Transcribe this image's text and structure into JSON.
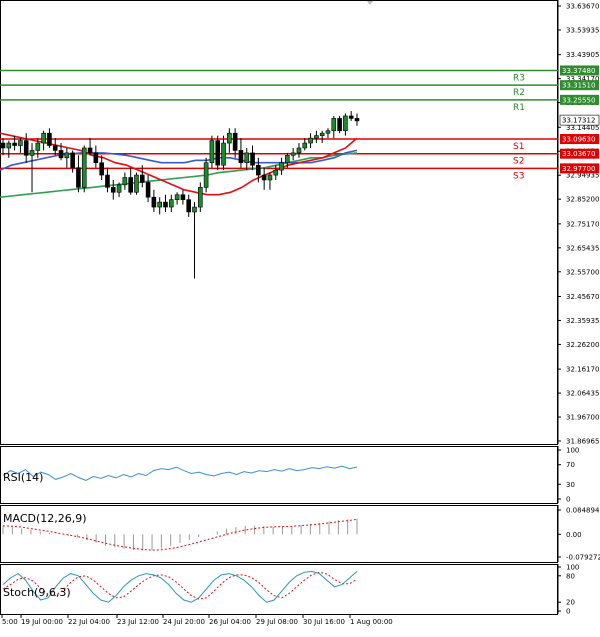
{
  "chart_data": [
    {
      "panel": "price",
      "type": "candlestick",
      "y_ticks": [
        "33.63670",
        "33.53935",
        "33.43905",
        "33.34170",
        "33.24435",
        "33.14405",
        "33.04670",
        "32.94935",
        "32.85200",
        "32.75170",
        "32.65435",
        "32.55700",
        "32.45670",
        "32.35935",
        "32.26200",
        "32.16170",
        "32.06435",
        "31.96700",
        "31.86965"
      ],
      "ylim": [
        31.86965,
        33.6367
      ],
      "current_price": {
        "value": 33.17312,
        "label": "33.17312"
      },
      "levels": [
        {
          "name": "R3",
          "value": 33.3748,
          "label": "33.37480",
          "color": "#2e8b2e"
        },
        {
          "name": "R2",
          "value": 33.3151,
          "label": "33.31510",
          "color": "#2e8b2e"
        },
        {
          "name": "R1",
          "value": 33.2555,
          "label": "33.25550",
          "color": "#2e8b2e"
        },
        {
          "name": "S1",
          "value": 33.0963,
          "label": "33.09630",
          "color": "#e00000"
        },
        {
          "name": "S2",
          "value": 33.0367,
          "label": "33.03670",
          "color": "#e00000"
        },
        {
          "name": "S3",
          "value": 32.977,
          "label": "32.97700",
          "color": "#e00000"
        }
      ],
      "candles": [
        [
          33.08,
          33.1,
          33.03,
          33.06
        ],
        [
          33.06,
          33.09,
          33.02,
          33.08
        ],
        [
          33.08,
          33.11,
          33.05,
          33.07
        ],
        [
          33.07,
          33.1,
          33.04,
          33.09
        ],
        [
          33.09,
          33.12,
          33.0,
          33.03
        ],
        [
          33.03,
          33.08,
          32.88,
          33.05
        ],
        [
          33.05,
          33.1,
          33.02,
          33.08
        ],
        [
          33.08,
          33.13,
          33.05,
          33.12
        ],
        [
          33.12,
          33.14,
          33.06,
          33.07
        ],
        [
          33.07,
          33.1,
          33.03,
          33.05
        ],
        [
          33.05,
          33.08,
          33.01,
          33.02
        ],
        [
          33.02,
          33.06,
          32.98,
          33.04
        ],
        [
          33.04,
          33.05,
          32.96,
          32.98
        ],
        [
          32.98,
          33.03,
          32.88,
          32.9
        ],
        [
          32.9,
          33.07,
          32.88,
          33.06
        ],
        [
          33.06,
          33.1,
          33.03,
          33.04
        ],
        [
          33.04,
          33.07,
          32.98,
          33.0
        ],
        [
          33.0,
          33.03,
          32.93,
          32.95
        ],
        [
          32.95,
          32.98,
          32.88,
          32.9
        ],
        [
          32.9,
          32.93,
          32.85,
          32.88
        ],
        [
          32.88,
          32.92,
          32.86,
          32.91
        ],
        [
          32.91,
          32.96,
          32.89,
          32.94
        ],
        [
          32.94,
          32.98,
          32.87,
          32.88
        ],
        [
          32.88,
          32.96,
          32.87,
          32.95
        ],
        [
          32.95,
          32.99,
          32.9,
          32.92
        ],
        [
          32.92,
          32.95,
          32.84,
          32.86
        ],
        [
          32.86,
          32.89,
          32.8,
          32.82
        ],
        [
          32.82,
          32.86,
          32.79,
          32.84
        ],
        [
          32.84,
          32.87,
          32.8,
          32.82
        ],
        [
          32.82,
          32.87,
          32.8,
          32.85
        ],
        [
          32.85,
          32.88,
          32.83,
          32.87
        ],
        [
          32.87,
          32.89,
          32.83,
          32.85
        ],
        [
          32.85,
          32.87,
          32.78,
          32.8
        ],
        [
          32.8,
          32.84,
          32.53,
          32.82
        ],
        [
          32.82,
          32.92,
          32.8,
          32.9
        ],
        [
          32.9,
          33.02,
          32.88,
          33.0
        ],
        [
          33.0,
          33.11,
          32.98,
          33.09
        ],
        [
          33.09,
          33.11,
          32.97,
          32.99
        ],
        [
          32.99,
          33.11,
          32.97,
          33.08
        ],
        [
          33.08,
          33.14,
          33.04,
          33.12
        ],
        [
          33.12,
          33.14,
          33.02,
          33.05
        ],
        [
          33.05,
          33.1,
          32.98,
          33.0
        ],
        [
          33.0,
          33.06,
          32.97,
          33.04
        ],
        [
          33.04,
          33.07,
          32.97,
          32.99
        ],
        [
          32.99,
          33.02,
          32.92,
          32.95
        ],
        [
          32.95,
          32.98,
          32.89,
          32.93
        ],
        [
          32.93,
          32.96,
          32.89,
          32.95
        ],
        [
          32.95,
          32.99,
          32.93,
          32.97
        ],
        [
          32.97,
          33.02,
          32.95,
          33.0
        ],
        [
          33.0,
          33.04,
          32.98,
          33.03
        ],
        [
          33.03,
          33.06,
          33.01,
          33.04
        ],
        [
          33.04,
          33.08,
          33.02,
          33.06
        ],
        [
          33.06,
          33.1,
          33.05,
          33.08
        ],
        [
          33.08,
          33.12,
          33.06,
          33.1
        ],
        [
          33.1,
          33.13,
          33.08,
          33.11
        ],
        [
          33.11,
          33.13,
          33.08,
          33.12
        ],
        [
          33.12,
          33.14,
          33.1,
          33.13
        ],
        [
          33.13,
          33.19,
          33.1,
          33.18
        ],
        [
          33.18,
          33.19,
          33.12,
          33.13
        ],
        [
          33.13,
          33.2,
          33.11,
          33.19
        ],
        [
          33.19,
          33.21,
          33.17,
          33.18
        ],
        [
          33.18,
          33.2,
          33.15,
          33.17
        ]
      ],
      "ma_red": [
        33.12,
        33.11,
        33.1,
        33.09,
        33.08,
        33.07,
        33.06,
        33.05,
        33.03,
        33.02,
        33.0,
        32.99,
        32.97,
        32.95,
        32.93,
        32.91,
        32.89,
        32.88,
        32.87,
        32.87,
        32.88,
        32.9,
        32.93,
        32.95,
        32.97,
        32.99,
        33.0,
        33.01,
        33.02,
        33.04,
        33.06,
        33.1
      ],
      "ma_blue": [
        32.97,
        32.99,
        33.0,
        33.01,
        33.02,
        33.03,
        33.035,
        33.04,
        33.04,
        33.04,
        33.035,
        33.03,
        33.02,
        33.01,
        33.0,
        33.0,
        33.0,
        33.01,
        33.01,
        33.02,
        33.02,
        33.01,
        33.0,
        33.0,
        33.0,
        33.0,
        33.0,
        33.0,
        33.01,
        33.02,
        33.04,
        33.05
      ],
      "ma_green": [
        32.86,
        32.865,
        32.87,
        32.875,
        32.88,
        32.885,
        32.89,
        32.895,
        32.9,
        32.905,
        32.91,
        32.915,
        32.92,
        32.925,
        32.93,
        32.935,
        32.94,
        32.945,
        32.95,
        32.96,
        32.965,
        32.97,
        32.975,
        32.98,
        32.99,
        33.0,
        33.01,
        33.02,
        33.02,
        33.03,
        33.035,
        33.04
      ],
      "x_ticks": [
        "5:00",
        "19 Jul 00:00",
        "22 Jul 04:00",
        "23 Jul 12:00",
        "24 Jul 20:00",
        "26 Jul 04:00",
        "29 Jul 08:00",
        "30 Jul 16:00",
        "1 Aug 00:00"
      ]
    },
    {
      "panel": "rsi",
      "type": "line",
      "title": "RSI(14)",
      "ylim": [
        0,
        100
      ],
      "y_ticks": [
        "100",
        "70",
        "30",
        "0"
      ],
      "values": [
        48,
        58,
        52,
        60,
        46,
        55,
        50,
        40,
        45,
        52,
        44,
        38,
        46,
        42,
        48,
        43,
        50,
        45,
        52,
        48,
        58,
        62,
        60,
        65,
        58,
        52,
        55,
        50,
        47,
        52,
        55,
        50,
        56,
        53,
        58,
        56,
        60,
        57,
        62,
        58,
        60,
        64,
        62,
        66,
        63,
        67,
        62,
        65
      ]
    },
    {
      "panel": "macd",
      "type": "bar",
      "title": "MACD(12,26,9)",
      "ylim": [
        -0.079272,
        0.084894
      ],
      "y_ticks": [
        "0.084894",
        "0.00",
        "-0.079272"
      ],
      "histogram": [
        0.03,
        0.025,
        0.02,
        0.015,
        0.01,
        0.005,
        0.0,
        -0.005,
        -0.01,
        -0.02,
        -0.03,
        -0.04,
        -0.045,
        -0.05,
        -0.055,
        -0.057,
        -0.055,
        -0.05,
        -0.04,
        -0.03,
        -0.02,
        -0.01,
        0.0,
        0.01,
        0.02,
        0.025,
        0.03,
        0.03,
        0.028,
        0.026,
        0.026,
        0.028,
        0.032,
        0.036,
        0.04,
        0.045,
        0.05,
        0.052,
        0.055
      ],
      "signal": [
        0.03,
        0.028,
        0.025,
        0.02,
        0.015,
        0.01,
        0.004,
        -0.002,
        -0.008,
        -0.015,
        -0.023,
        -0.031,
        -0.038,
        -0.044,
        -0.049,
        -0.053,
        -0.055,
        -0.054,
        -0.05,
        -0.044,
        -0.036,
        -0.027,
        -0.018,
        -0.009,
        0.0,
        0.008,
        0.015,
        0.02,
        0.024,
        0.026,
        0.027,
        0.028,
        0.03,
        0.033,
        0.036,
        0.04,
        0.044,
        0.048,
        0.052
      ]
    },
    {
      "panel": "stoch",
      "type": "line",
      "title": "Stoch(9,6,3)",
      "ylim": [
        0,
        100
      ],
      "y_ticks": [
        "100",
        "80",
        "20",
        "0"
      ],
      "main": [
        60,
        75,
        85,
        70,
        45,
        25,
        30,
        55,
        75,
        85,
        80,
        60,
        40,
        25,
        20,
        35,
        55,
        70,
        80,
        85,
        82,
        75,
        60,
        40,
        25,
        20,
        30,
        50,
        70,
        82,
        85,
        80,
        70,
        55,
        35,
        20,
        25,
        45,
        65,
        80,
        88,
        90,
        85,
        70,
        55,
        60,
        75,
        90
      ],
      "signal": [
        50,
        60,
        72,
        76,
        68,
        52,
        38,
        35,
        48,
        65,
        78,
        80,
        70,
        55,
        40,
        30,
        32,
        45,
        60,
        72,
        80,
        82,
        78,
        66,
        50,
        35,
        27,
        30,
        45,
        62,
        76,
        82,
        82,
        76,
        64,
        48,
        35,
        30,
        40,
        55,
        70,
        82,
        88,
        84,
        72,
        62,
        62,
        72
      ]
    }
  ]
}
